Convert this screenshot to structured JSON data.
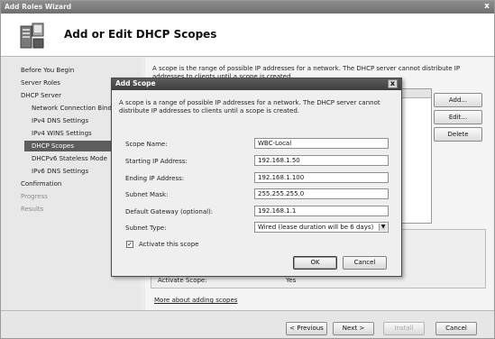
{
  "wizard": {
    "title": "Add Roles Wizard",
    "close_glyph": "x",
    "header_title": "Add or Edit DHCP Scopes",
    "nav": [
      {
        "label": "Before You Begin",
        "level": "top",
        "state": "normal"
      },
      {
        "label": "Server Roles",
        "level": "top",
        "state": "normal"
      },
      {
        "label": "DHCP Server",
        "level": "top",
        "state": "normal"
      },
      {
        "label": "Network Connection Bindings",
        "level": "sub",
        "state": "normal"
      },
      {
        "label": "IPv4 DNS Settings",
        "level": "sub",
        "state": "normal"
      },
      {
        "label": "IPv4 WINS Settings",
        "level": "sub",
        "state": "normal"
      },
      {
        "label": "DHCP Scopes",
        "level": "sub",
        "state": "selected"
      },
      {
        "label": "DHCPv6 Stateless Mode",
        "level": "sub",
        "state": "normal"
      },
      {
        "label": "IPv6 DNS Settings",
        "level": "sub",
        "state": "normal"
      },
      {
        "label": "Confirmation",
        "level": "top",
        "state": "normal"
      },
      {
        "label": "Progress",
        "level": "top",
        "state": "muted"
      },
      {
        "label": "Results",
        "level": "top",
        "state": "muted"
      }
    ],
    "intro_text": "A scope is the range of possible IP addresses for a network. The DHCP server cannot distribute IP addresses to clients until a scope is created.",
    "side_buttons": {
      "add": "Add...",
      "edit": "Edit...",
      "delete": "Delete"
    },
    "summary": {
      "activate_scope_label": "Activate Scope:",
      "activate_scope_value": "Yes"
    },
    "more_link": "More about adding scopes",
    "footer": {
      "previous": "< Previous",
      "next": "Next >",
      "install": "Install",
      "cancel": "Cancel"
    }
  },
  "dialog": {
    "title": "Add Scope",
    "close_glyph": "x",
    "description": "A scope is a range of possible IP addresses for a network. The DHCP server cannot distribute IP addresses to clients until a scope is created.",
    "fields": {
      "scope_name": {
        "label": "Scope Name:",
        "value": "WBC-Local"
      },
      "starting_ip": {
        "label": "Starting IP Address:",
        "value": "192.168.1.50"
      },
      "ending_ip": {
        "label": "Ending IP Address:",
        "value": "192.168.1.100"
      },
      "subnet_mask": {
        "label": "Subnet Mask:",
        "value": "255.255.255.0"
      },
      "default_gateway": {
        "label": "Default Gateway (optional):",
        "value": "192.168.1.1"
      },
      "subnet_type": {
        "label": "Subnet Type:",
        "value": "Wired (lease duration will be 6 days)"
      }
    },
    "activate_checkbox": {
      "label": "Activate this scope",
      "checked": true
    },
    "ok_label": "OK",
    "cancel_label": "Cancel"
  }
}
